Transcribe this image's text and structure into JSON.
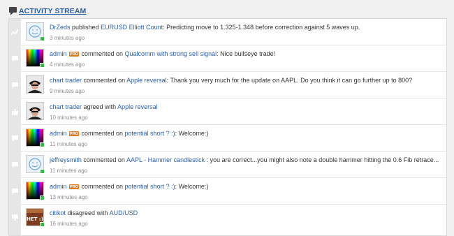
{
  "header": {
    "title": "ACTIVITY STREAM"
  },
  "rows": [
    {
      "user": "DrZeds",
      "verb": "published",
      "target": "EURUSD Elliott Count",
      "text": ": Predicting move to 1.325-1.348 before correction against 5 waves up.",
      "time": "3 minutes ago",
      "type_icon": "chart-icon",
      "avatar": "smiley-avatar",
      "online": true
    },
    {
      "user": "admin",
      "badge": "PRO",
      "verb": "commented on",
      "target": "Qualcomm with strong sell signal",
      "text": ": Nice bullseye trade!",
      "time": "4 minutes ago",
      "type_icon": "comment-icon",
      "avatar": "gradient-avatar",
      "online": true
    },
    {
      "user": "chart trader",
      "verb": "commented on",
      "target": "Apple reversal",
      "text": ": Thank you very much for the update on AAPL. Do you think it can go further up to 800?",
      "time": "9 minutes ago",
      "type_icon": "comment-icon",
      "avatar": "photo-avatar",
      "online": false
    },
    {
      "user": "chart trader",
      "verb": "agreed with",
      "target": "Apple reversal",
      "text": "",
      "time": "10 minutes ago",
      "type_icon": "thumbs-up-icon",
      "avatar": "photo-avatar",
      "online": false
    },
    {
      "user": "admin",
      "badge": "PRO",
      "verb": "commented on",
      "target": "potential short ? :)",
      "text": ": Welcome:)",
      "time": "11 minutes ago",
      "type_icon": "comment-icon",
      "avatar": "gradient-avatar",
      "online": true
    },
    {
      "user": "jeffreysmith",
      "verb": "commented on",
      "target": "AAPL - Hammer candlestick",
      "text": " : you are correct...you might also note a double hammer hitting the 0.6 Fib retrace...",
      "time": "11 minutes ago",
      "type_icon": "comment-icon",
      "avatar": "smiley-avatar",
      "online": true
    },
    {
      "user": "admin",
      "badge": "PRO",
      "verb": "commented on",
      "target": "potential short ? :)",
      "text": ": Welcome:)",
      "time": "13 minutes ago",
      "type_icon": "comment-icon",
      "avatar": "gradient-avatar",
      "online": true
    },
    {
      "user": "citikot",
      "verb": "disagreed with",
      "target": "AUD/USD",
      "text": "",
      "time": "16 minutes ago",
      "type_icon": "thumbs-down-icon",
      "avatar": "meme-avatar",
      "avatar_text": "HET :)",
      "online": true
    }
  ],
  "colors": {
    "link": "#2a5ea8",
    "pro_badge": "#e07a1a",
    "online": "#3bb24a"
  }
}
